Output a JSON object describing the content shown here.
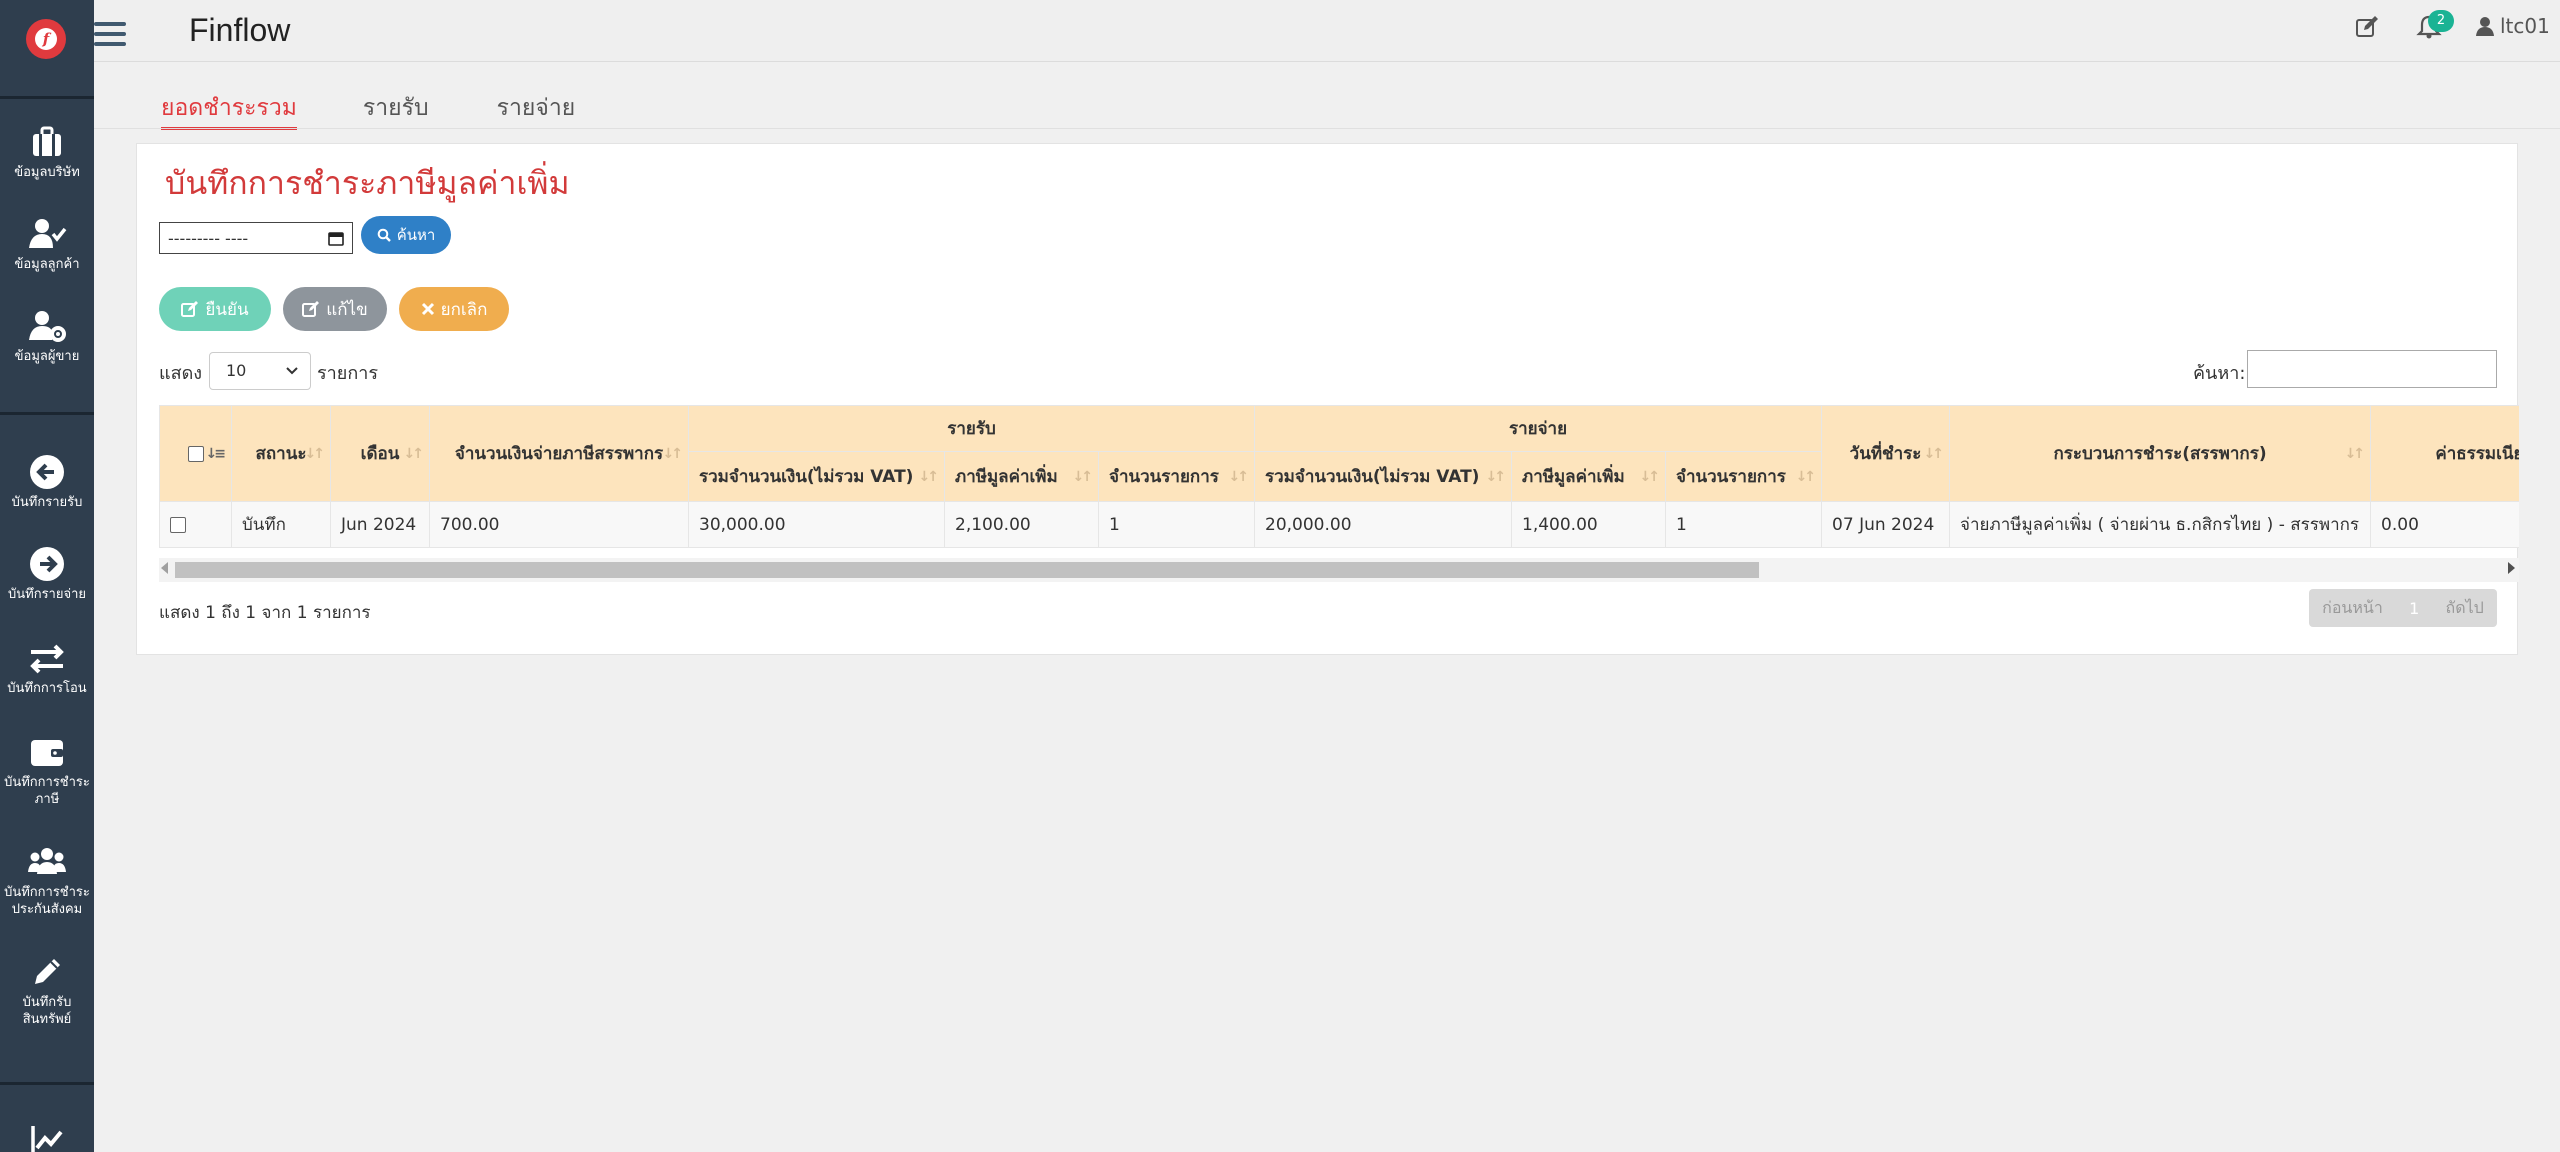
{
  "app": {
    "title": "Finflow",
    "notification_count": "2",
    "username": "ltc01"
  },
  "sidebar": {
    "items": [
      {
        "label": "ข้อมูลบริษัท",
        "icon": "briefcase-icon"
      },
      {
        "label": "ข้อมูลลูกค้า",
        "icon": "user-check-icon"
      },
      {
        "label": "ข้อมูลผู้ขาย",
        "icon": "user-gear-icon"
      },
      {
        "label": "บันทึกรายรับ",
        "icon": "arrow-left-circle-icon"
      },
      {
        "label": "บันทึกรายจ่าย",
        "icon": "arrow-right-circle-icon"
      },
      {
        "label": "บันทึกการโอน",
        "icon": "exchange-icon"
      },
      {
        "label": "บันทึกการชำระ\nภาษี",
        "icon": "wallet-icon"
      },
      {
        "label": "บันทึกการชำระ\nประกันสังคม",
        "icon": "users-icon"
      },
      {
        "label": "บันทึกรับ\nสินทรัพย์",
        "icon": "pencil-icon"
      }
    ]
  },
  "tabs": [
    {
      "label": "ยอดชำระรวม",
      "active": true
    },
    {
      "label": "รายรับ",
      "active": false
    },
    {
      "label": "รายจ่าย",
      "active": false
    }
  ],
  "page": {
    "title": "บันทึกการชำระภาษีมูลค่าเพิ่ม"
  },
  "filters": {
    "month_value": "--------- ----",
    "search_button": "ค้นหา"
  },
  "actions": {
    "confirm": "ยืนยัน",
    "edit": "แก้ไข",
    "cancel": "ยกเลิก"
  },
  "table_controls": {
    "length_prefix": "แสดง",
    "length_value": "10",
    "length_suffix": "รายการ",
    "search_label": "ค้นหา:"
  },
  "table": {
    "group_headers": {
      "income": "รายรับ",
      "expense": "รายจ่าย"
    },
    "columns": {
      "status": "สถานะ",
      "month": "เดือน",
      "tax_paid": "จำนวนเงินจ่ายภาษีสรรพากร",
      "inc_total": "รวมจำนวนเงิน(ไม่รวม VAT)",
      "inc_vat": "ภาษีมูลค่าเพิ่ม",
      "inc_count": "จำนวนรายการ",
      "exp_total": "รวมจำนวนเงิน(ไม่รวม VAT)",
      "exp_vat": "ภาษีมูลค่าเพิ่ม",
      "exp_count": "จำนวนรายการ",
      "pay_date": "วันที่ชำระ",
      "pay_method": "กระบวนการชำระ(สรรพากร)",
      "fee": "ค่าธรรมเนียม"
    },
    "rows": [
      {
        "status": "บันทึก",
        "month": "Jun 2024",
        "tax_paid": "700.00",
        "inc_total": "30,000.00",
        "inc_vat": "2,100.00",
        "inc_count": "1",
        "exp_total": "20,000.00",
        "exp_vat": "1,400.00",
        "exp_count": "1",
        "pay_date": "07 Jun 2024",
        "pay_method": "จ่ายภาษีมูลค่าเพิ่ม ( จ่ายผ่าน ธ.กสิกรไทย ) - สรรพากร",
        "fee": "0.00"
      }
    ]
  },
  "footer": {
    "info": "แสดง 1 ถึง 1 จาก 1 รายการ",
    "prev": "ก่อนหน้า",
    "page": "1",
    "next": "ถัดไป"
  }
}
